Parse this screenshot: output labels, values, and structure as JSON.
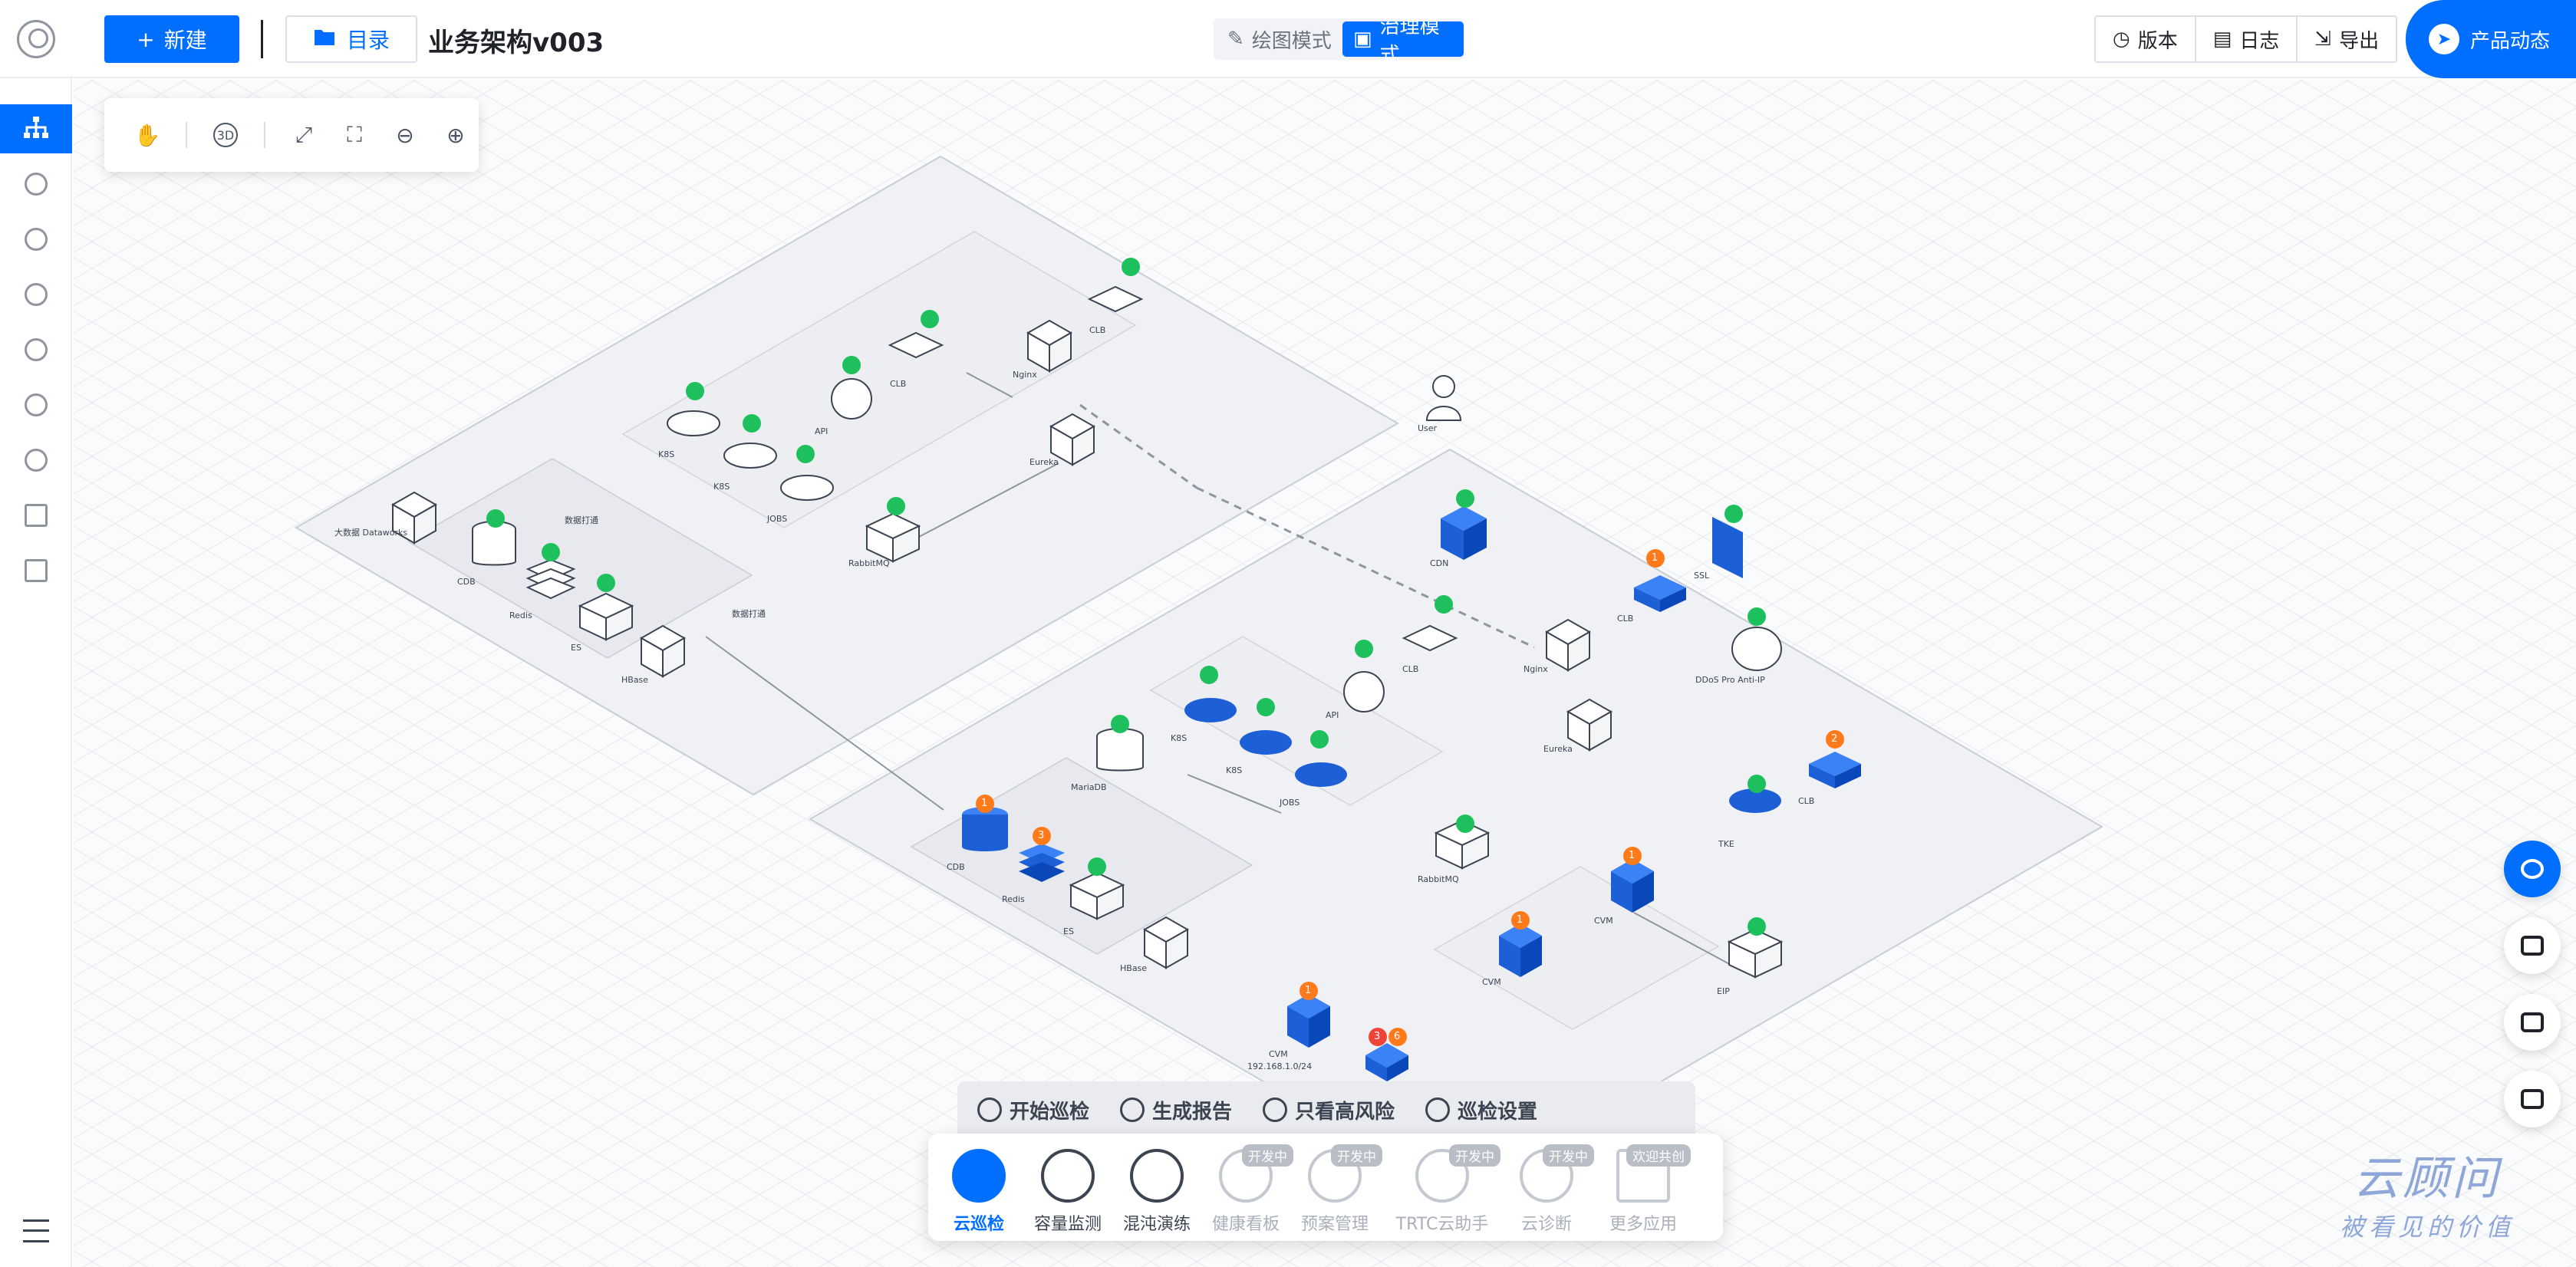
{
  "header": {
    "new_label": "新建",
    "dir_label": "目录",
    "title": "业务架构v003",
    "mode_draw": "绘图模式",
    "mode_gov": "治理模式",
    "version_label": "版本",
    "log_label": "日志",
    "export_label": "导出",
    "news_label": "产品动态"
  },
  "sidebar": {
    "items": [
      "architecture-icon",
      "monitor-icon",
      "gauge-icon",
      "cloud-check-icon",
      "gear-dial-icon",
      "rocket-icon",
      "chart-icon",
      "book-icon",
      "pin-icon"
    ],
    "active": 0
  },
  "toolbar": {
    "tools": [
      "hand-icon",
      "3d-icon",
      "fit-icon",
      "fullscreen-icon",
      "zoom-out-icon",
      "zoom-in-icon"
    ],
    "view_3d": "3D"
  },
  "diagram": {
    "top_region": {
      "labels": {
        "k8s1": "K8S",
        "k8s2": "K8S",
        "jobs": "JOBS",
        "api": "API",
        "clb1": "CLB",
        "clb2": "CLB",
        "nginx": "Nginx",
        "eureka": "Eureka",
        "rabbitmq": "RabbitMQ",
        "cdb": "CDB",
        "redis": "Redis",
        "es": "ES",
        "hbase": "HBase",
        "dataworks": "大数据 Dataworks",
        "data_link1": "数据打通",
        "data_link2": "数据打通"
      }
    },
    "user_label": "User",
    "bottom_region": {
      "labels": {
        "cdn": "CDN",
        "ssl": "SSL",
        "clb3": "CLB",
        "ddos": "DDoS Pro Anti-IP",
        "clb4": "CLB",
        "nginx": "Nginx",
        "api": "API",
        "eureka": "Eureka",
        "k8s1": "K8S",
        "k8s2": "K8S",
        "jobs": "JOBS",
        "mariadb": "MariaDB",
        "cdb": "CDB",
        "redis": "Redis",
        "es": "ES",
        "hbase": "HBase",
        "rabbitmq": "RabbitMQ",
        "tke": "TKE",
        "clb5": "CLB",
        "cvm1": "CVM",
        "cvm2": "CVM",
        "eip": "EIP",
        "cvm3": "CVM",
        "cvm3_ip": "192.168.1.0/24"
      }
    },
    "badges": {
      "orange": [
        "1",
        "1",
        "3",
        "1",
        "2",
        "1",
        "1",
        "3",
        "6"
      ]
    }
  },
  "actions": {
    "start": "开始巡检",
    "report": "生成报告",
    "high_risk": "只看高风险",
    "settings": "巡检设置"
  },
  "dock": {
    "apps": [
      {
        "name": "云巡检",
        "tag": ""
      },
      {
        "name": "容量监测",
        "tag": ""
      },
      {
        "name": "混沌演练",
        "tag": ""
      },
      {
        "name": "健康看板",
        "tag": "开发中"
      },
      {
        "name": "预案管理",
        "tag": "开发中"
      },
      {
        "name": "TRTC云助手",
        "tag": "开发中"
      },
      {
        "name": "云诊断",
        "tag": "开发中"
      },
      {
        "name": "更多应用",
        "tag": "欢迎共创"
      }
    ]
  },
  "watermark": {
    "line1": "云顾问",
    "line2": "被看见的价值"
  },
  "colors": {
    "accent": "#006eff",
    "check": "#1ec05d",
    "warn": "#ff7a1a",
    "danger": "#f04438"
  }
}
